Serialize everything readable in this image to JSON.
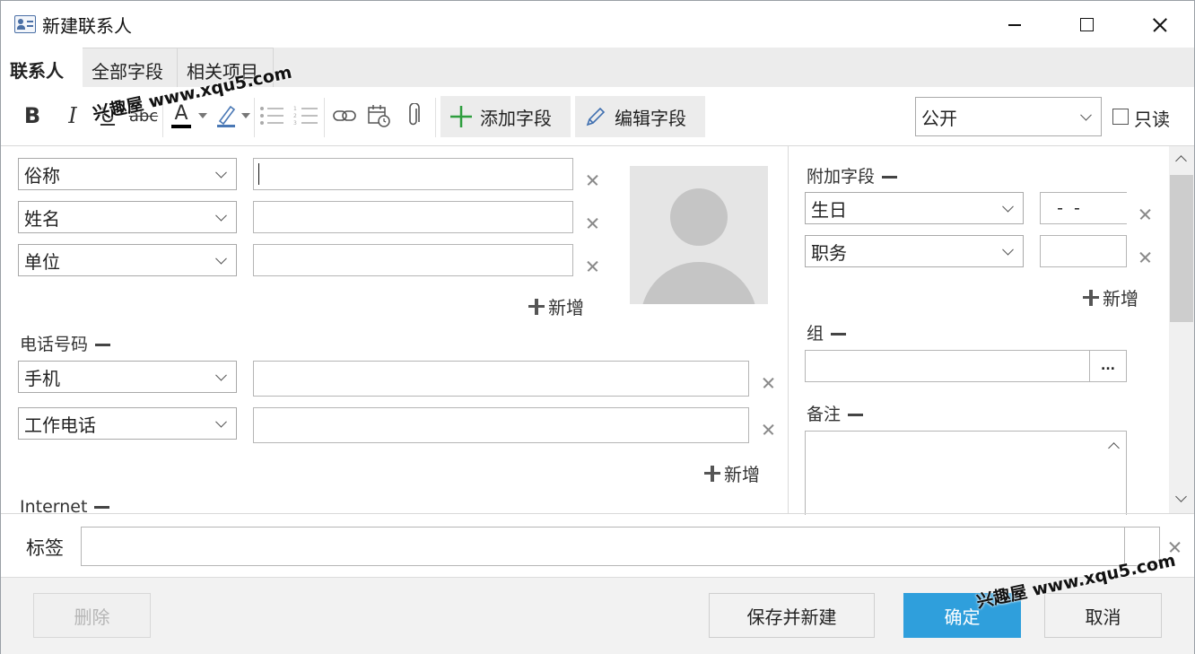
{
  "window": {
    "title": "新建联系人"
  },
  "tabs": [
    {
      "label": "联系人",
      "active": true
    },
    {
      "label": "全部字段",
      "active": false
    },
    {
      "label": "相关项目",
      "active": false
    }
  ],
  "toolbar": {
    "bold": "B",
    "italic": "I",
    "underline": "U",
    "strike": "abc",
    "font_color": "A",
    "add_field_label": "添加字段",
    "edit_field_label": "编辑字段",
    "visibility_value": "公开",
    "readonly_label": "只读"
  },
  "left": {
    "name_fields": [
      {
        "type": "俗称",
        "value": ""
      },
      {
        "type": "姓名",
        "value": ""
      },
      {
        "type": "单位",
        "value": ""
      }
    ],
    "add_label": "新增",
    "phone_section": "电话号码",
    "phone_fields": [
      {
        "type": "手机",
        "value": ""
      },
      {
        "type": "工作电话",
        "value": ""
      }
    ],
    "phone_add_label": "新增",
    "internet_section": "Internet"
  },
  "right": {
    "extra_section": "附加字段",
    "extra_fields": [
      {
        "type": "生日",
        "value": "  -  -"
      },
      {
        "type": "职务",
        "value": ""
      }
    ],
    "extra_add_label": "新增",
    "group_section": "组",
    "group_browse": "...",
    "notes_section": "备注"
  },
  "tags": {
    "label": "标签",
    "value": ""
  },
  "footer": {
    "delete_label": "删除",
    "save_new_label": "保存并新建",
    "ok_label": "确定",
    "cancel_label": "取消"
  },
  "watermarks": [
    "兴趣屋 www.xqu5.com",
    "兴趣屋 www.xqu5.com"
  ],
  "colors": {
    "primary": "#2f9fdc",
    "text": "#222222",
    "border": "#b5b5b5"
  }
}
